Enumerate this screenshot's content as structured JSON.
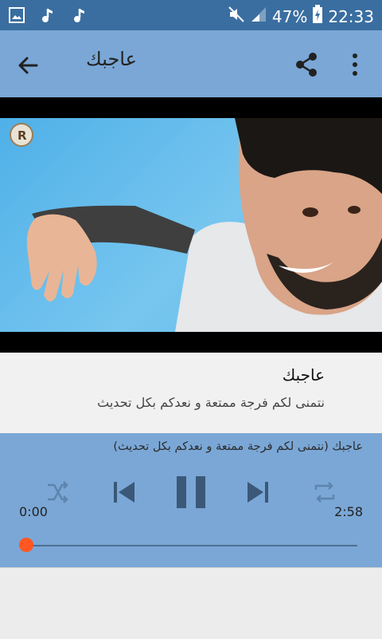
{
  "status_bar": {
    "battery": "47%",
    "time": "22:33",
    "icons": [
      "image-icon",
      "music-note-icon",
      "music-note-icon",
      "mute-icon",
      "signal-icon",
      "battery-charging-icon"
    ]
  },
  "app_bar": {
    "title": "عاجبك",
    "icons": [
      "back-arrow-icon",
      "share-icon",
      "more-vert-icon"
    ]
  },
  "video": {
    "logo_icon": "r-logo-icon"
  },
  "track": {
    "title": "عاجبك",
    "subtitle": "نتمنى لكم فرجة ممتعة و نعدكم بكل تحديث"
  },
  "player": {
    "now_playing": "عاجبك (نتمنى لكم فرجة ممتعة و نعدكم بكل تحديث)",
    "elapsed": "0:00",
    "total": "2:58",
    "progress": 0.0,
    "controls": [
      "shuffle-icon",
      "previous-icon",
      "pause-icon",
      "next-icon",
      "repeat-icon"
    ]
  },
  "colors": {
    "status_bar": "#3a6ea0",
    "app_bar": "#7aa7d6",
    "accent": "#ff5722",
    "play_icon": "#e8731c"
  }
}
